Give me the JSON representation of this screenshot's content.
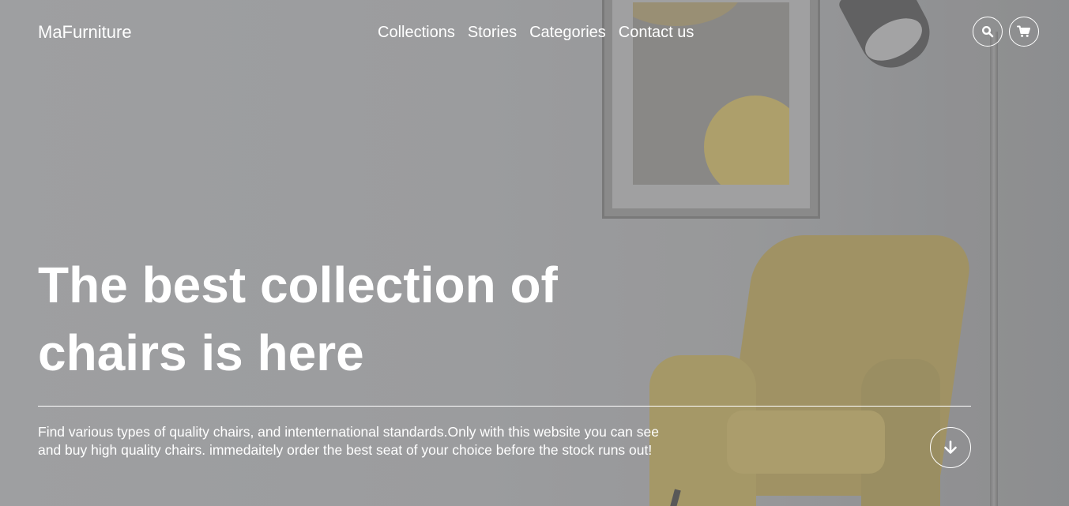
{
  "header": {
    "brand": "MaFurniture",
    "nav": [
      {
        "label": "Collections"
      },
      {
        "label": "Stories"
      },
      {
        "label": "Categories"
      },
      {
        "label": "Contact us"
      }
    ],
    "actions": {
      "search_icon": "search-icon",
      "cart_icon": "cart-icon"
    }
  },
  "hero": {
    "headline": "The best collection of chairs is here",
    "description": "Find various types of quality chairs, and intenternational standards.Only with this website you can see and buy high quality chairs. immedaitely order the best seat of your choice before the stock runs out!",
    "scroll_icon": "arrow-down-icon"
  },
  "colors": {
    "text": "#ffffff",
    "background": "#a0a1a3",
    "accent_chair": "#a59662"
  }
}
